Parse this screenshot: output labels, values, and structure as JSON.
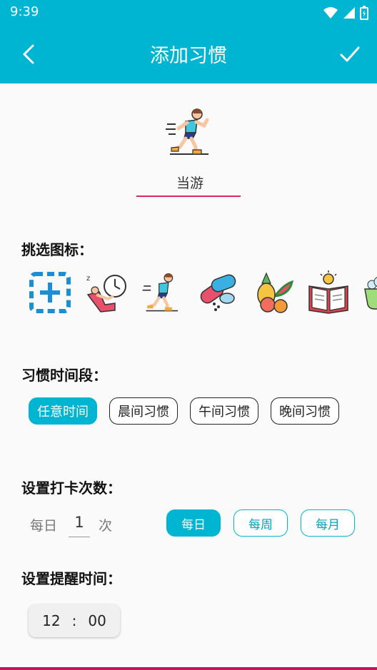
{
  "status": {
    "time": "9:39"
  },
  "header": {
    "title": "添加习惯"
  },
  "habit": {
    "name": "当游",
    "selected_icon": "running-icon"
  },
  "icons": {
    "title": "挑选图标：",
    "items": [
      "add-custom-icon",
      "relax-clock-icon",
      "running-icon",
      "pills-icon",
      "fruits-icon",
      "book-idea-icon",
      "bathtub-icon"
    ]
  },
  "time_period": {
    "title": "习惯时间段：",
    "options": [
      "任意时间",
      "晨间习惯",
      "午间习惯",
      "晚间习惯"
    ],
    "selected": "任意时间"
  },
  "checkin": {
    "title": "设置打卡次数：",
    "prefix": "每日",
    "count": "1",
    "suffix": "次",
    "periods": [
      "每日",
      "每周",
      "每月"
    ],
    "selected_period": "每日"
  },
  "reminder": {
    "title": "设置提醒时间：",
    "hour": "12",
    "separator": ":",
    "minute": "00"
  },
  "colors": {
    "primary": "#00b5d1",
    "underline": "#e0245e"
  }
}
